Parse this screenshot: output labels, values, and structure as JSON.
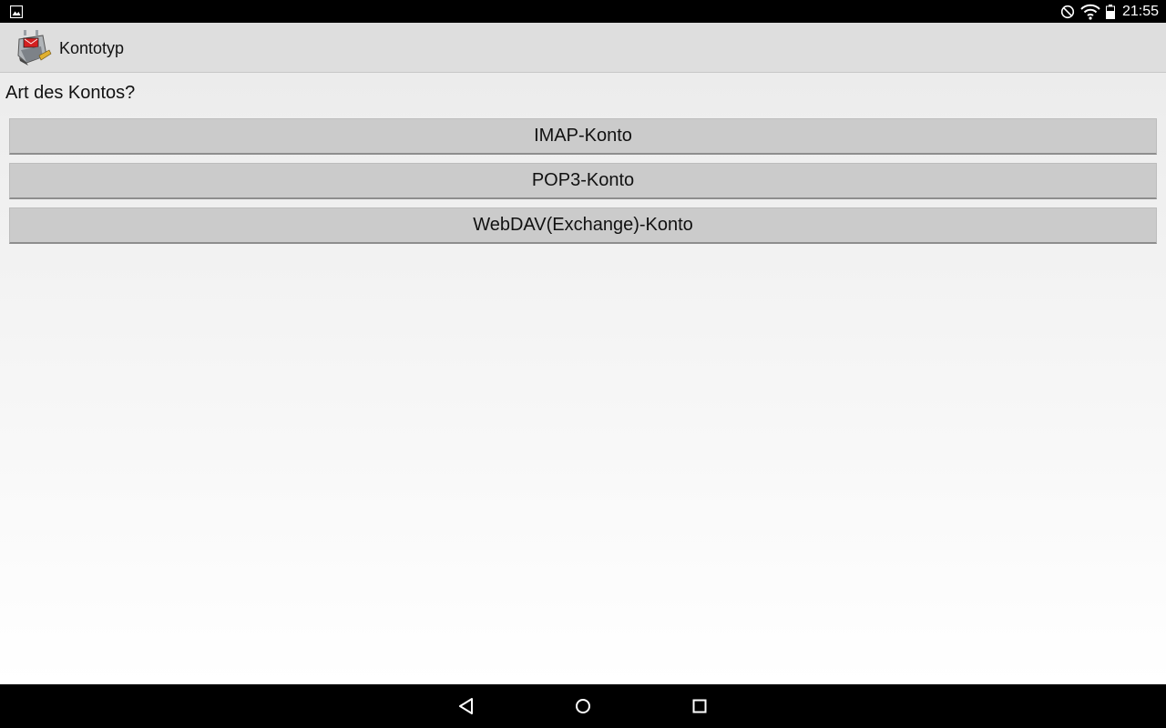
{
  "status_bar": {
    "time": "21:55",
    "icons": [
      "image-notification-icon",
      "do-not-disturb-icon",
      "wifi-icon",
      "battery-icon"
    ]
  },
  "action_bar": {
    "title": "Kontotyp",
    "icon": "app-logo-icon"
  },
  "content": {
    "prompt": "Art des Kontos?",
    "buttons": [
      {
        "label": "IMAP-Konto"
      },
      {
        "label": "POP3-Konto"
      },
      {
        "label": "WebDAV(Exchange)-Konto"
      }
    ]
  },
  "nav_bar": {
    "icons": [
      "back-icon",
      "home-icon",
      "recent-apps-icon"
    ]
  },
  "colors": {
    "status_bar_bg": "#000000",
    "action_bar_bg": "#dedede",
    "button_bg": "#cbcbcb",
    "nav_bar_bg": "#000000"
  }
}
